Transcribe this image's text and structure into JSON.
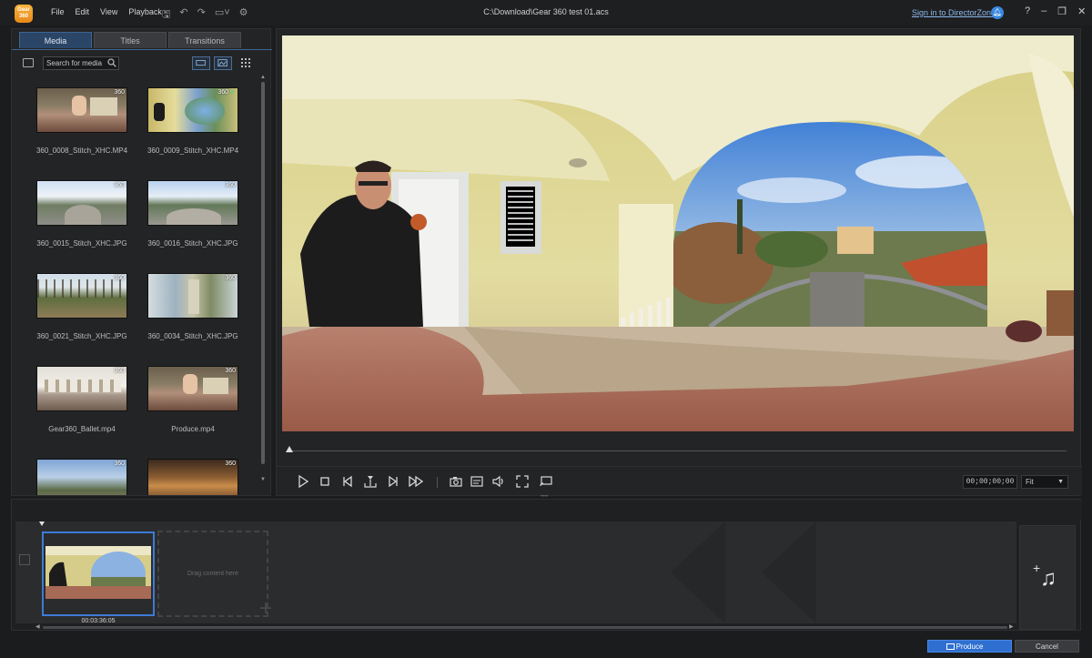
{
  "app": {
    "logo_text": "Gear 360",
    "menu": [
      "File",
      "Edit",
      "View",
      "Playback"
    ],
    "file_path": "C:\\Download\\Gear 360 test 01.acs",
    "signin_link": "Sign in to DirectorZone",
    "window_buttons": [
      "?",
      "–",
      "❐",
      "✕"
    ]
  },
  "library": {
    "tabs": [
      {
        "label": "Media",
        "active": true
      },
      {
        "label": "Titles",
        "active": false
      },
      {
        "label": "Transitions",
        "active": false
      }
    ],
    "search_placeholder": "Search for media",
    "items": [
      {
        "name": "360_0008_Stitch_XHC.MP4",
        "badge": "360",
        "checked": false
      },
      {
        "name": "360_0009_Stitch_XHC.MP4",
        "badge": "360",
        "checked": true
      },
      {
        "name": "360_0015_Stitch_XHC.JPG",
        "badge": "360",
        "checked": false
      },
      {
        "name": "360_0016_Stitch_XHC.JPG",
        "badge": "360",
        "checked": false
      },
      {
        "name": "360_0021_Stitch_XHC.JPG",
        "badge": "360",
        "checked": false
      },
      {
        "name": "360_0034_Stitch_XHC.JPG",
        "badge": "360",
        "checked": false
      },
      {
        "name": "Gear360_Ballet.mp4",
        "badge": "360",
        "checked": false
      },
      {
        "name": "Produce.mp4",
        "badge": "360",
        "checked": false
      },
      {
        "name": "",
        "badge": "360",
        "checked": false
      },
      {
        "name": "",
        "badge": "360",
        "checked": false
      }
    ]
  },
  "preview": {
    "timecode": "00;00;00;00",
    "zoom": "Fit",
    "controls": [
      "play-icon",
      "stop-icon",
      "previous-frame-icon",
      "split-icon",
      "next-frame-icon",
      "fast-forward-icon",
      "snapshot-icon",
      "subtitle-icon",
      "volume-icon",
      "fullscreen-icon",
      "external-display-icon"
    ]
  },
  "timeline": {
    "clip_duration": "00:03:36:05",
    "drop_hint": "Drag content here"
  },
  "footer": {
    "produce_label": "Produce",
    "cancel_label": "Cancel"
  },
  "colors": {
    "accent": "#2f6fd0",
    "panel": "#232426",
    "background": "#1b1c1e"
  }
}
